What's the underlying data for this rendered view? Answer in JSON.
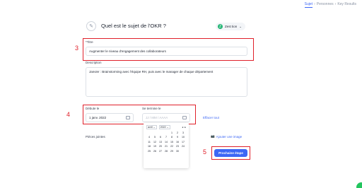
{
  "steps": [
    "Sujet",
    "Personnes",
    "Key Results"
  ],
  "header": {
    "title": "Quel est le sujet de l'OKR ?",
    "owner_initial": "Z",
    "owner_name": "Zest tion"
  },
  "title_field": {
    "label": "Titre",
    "value": "Augmenter le niveau d'engagement des collaborateurs"
  },
  "description_field": {
    "label": "Description",
    "value": "Janvier : Brainstorming avec l'équipe RH, puis avec le manager de chaque département"
  },
  "dates": {
    "start_label": "Débute le",
    "start_value": "1 janv. 2022",
    "end_label": "Se termine le",
    "end_placeholder": "JJ / MM / AAAA",
    "clear_label": "Effacer tout"
  },
  "attachments": {
    "label": "Pièces jointes",
    "add_image": "Ajouter une image"
  },
  "calendar": {
    "month": "avril",
    "year": "2022",
    "prev": "◂",
    "next": "▸",
    "days": [
      "",
      "",
      "",
      "",
      "1",
      "2",
      "3",
      "4",
      "5",
      "6",
      "7",
      "8",
      "9",
      "10",
      "11",
      "12",
      "13",
      "14",
      "15",
      "16",
      "17",
      "18",
      "19",
      "20",
      "21",
      "22",
      "23",
      "24",
      "25",
      "26",
      "27",
      "28",
      "29",
      "30",
      ""
    ]
  },
  "next_button": "Prochaine étape",
  "annotations": [
    "3",
    "4",
    "5"
  ],
  "colors": {
    "accent": "#3d67f5",
    "annotation": "#e0202a",
    "owner": "#22b573"
  }
}
